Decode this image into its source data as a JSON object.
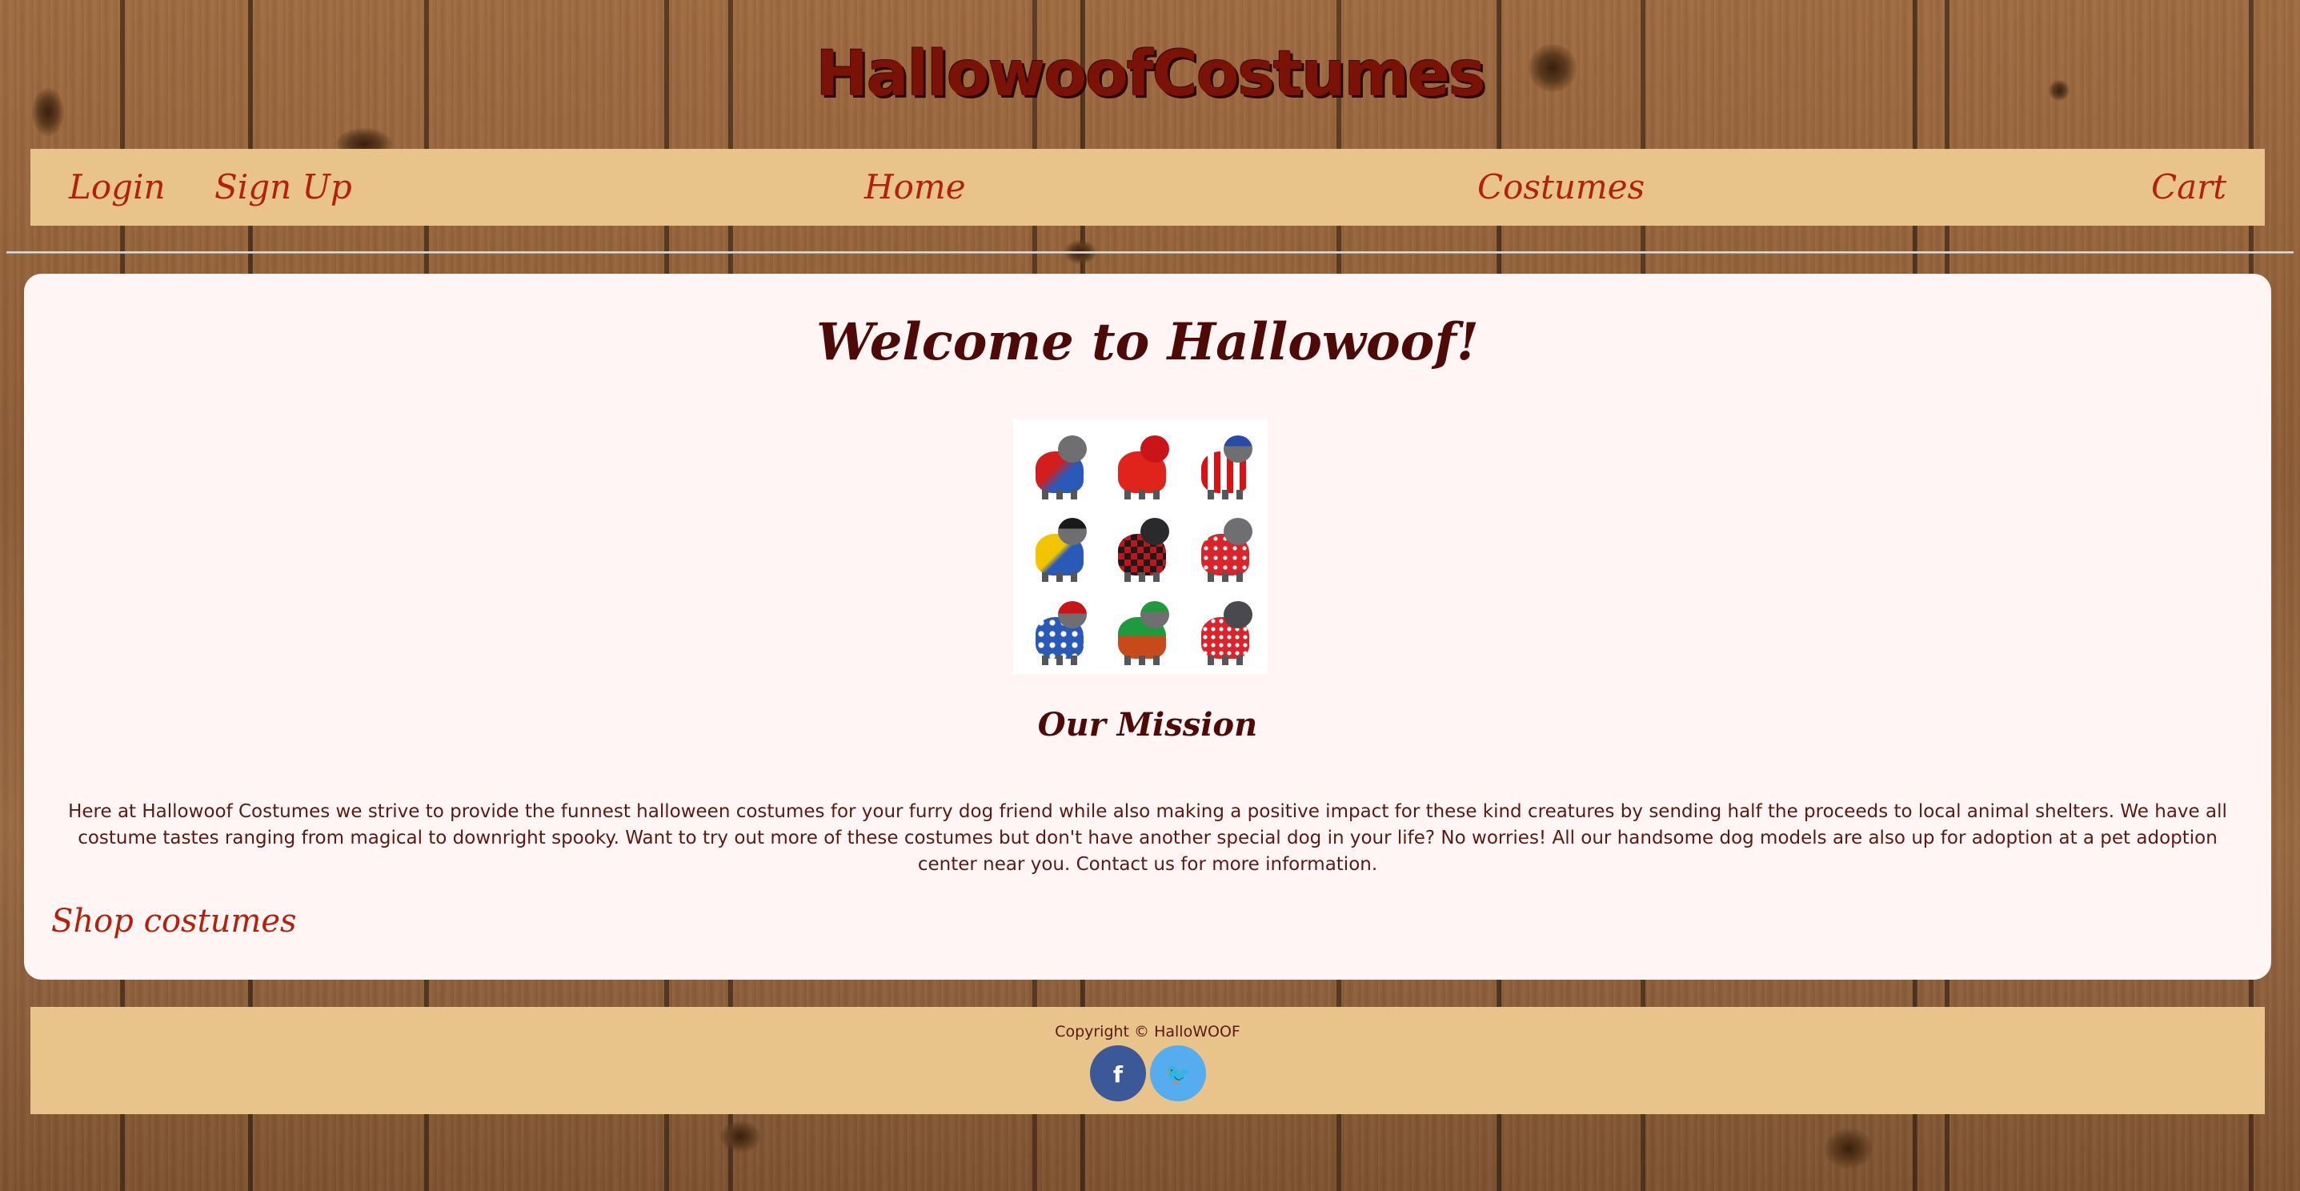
{
  "site": {
    "title": "HallowoofCostumes"
  },
  "nav": {
    "login": "Login",
    "signup": "Sign Up",
    "home": "Home",
    "costumes": "Costumes",
    "cart": "Cart"
  },
  "main": {
    "welcome": "Welcome to Hallowoof!",
    "mission_title": "Our Mission",
    "mission_text": "Here at Hallowoof Costumes we strive to provide the funnest halloween costumes for your furry dog friend while also making a positive impact for these kind creatures by sending half the proceeds to local animal shelters. We have all costume tastes ranging from magical to downright spooky. Want to try out more of these costumes but don't have another special dog in your life? No worries! All our handsome dog models are also up for adoption at a pet adoption center near you. Contact us for more information.",
    "shop_link": "Shop costumes"
  },
  "footer": {
    "copyright": "Copyright © HalloWOOF",
    "facebook_icon": "f",
    "twitter_icon": "🐦"
  },
  "colors": {
    "title_red": "#7a1208",
    "nav_bg": "#e8c38a",
    "link_red": "#b3200c",
    "card_bg": "#fff5f4",
    "facebook_blue": "#3b5998",
    "twitter_blue": "#55acee"
  }
}
